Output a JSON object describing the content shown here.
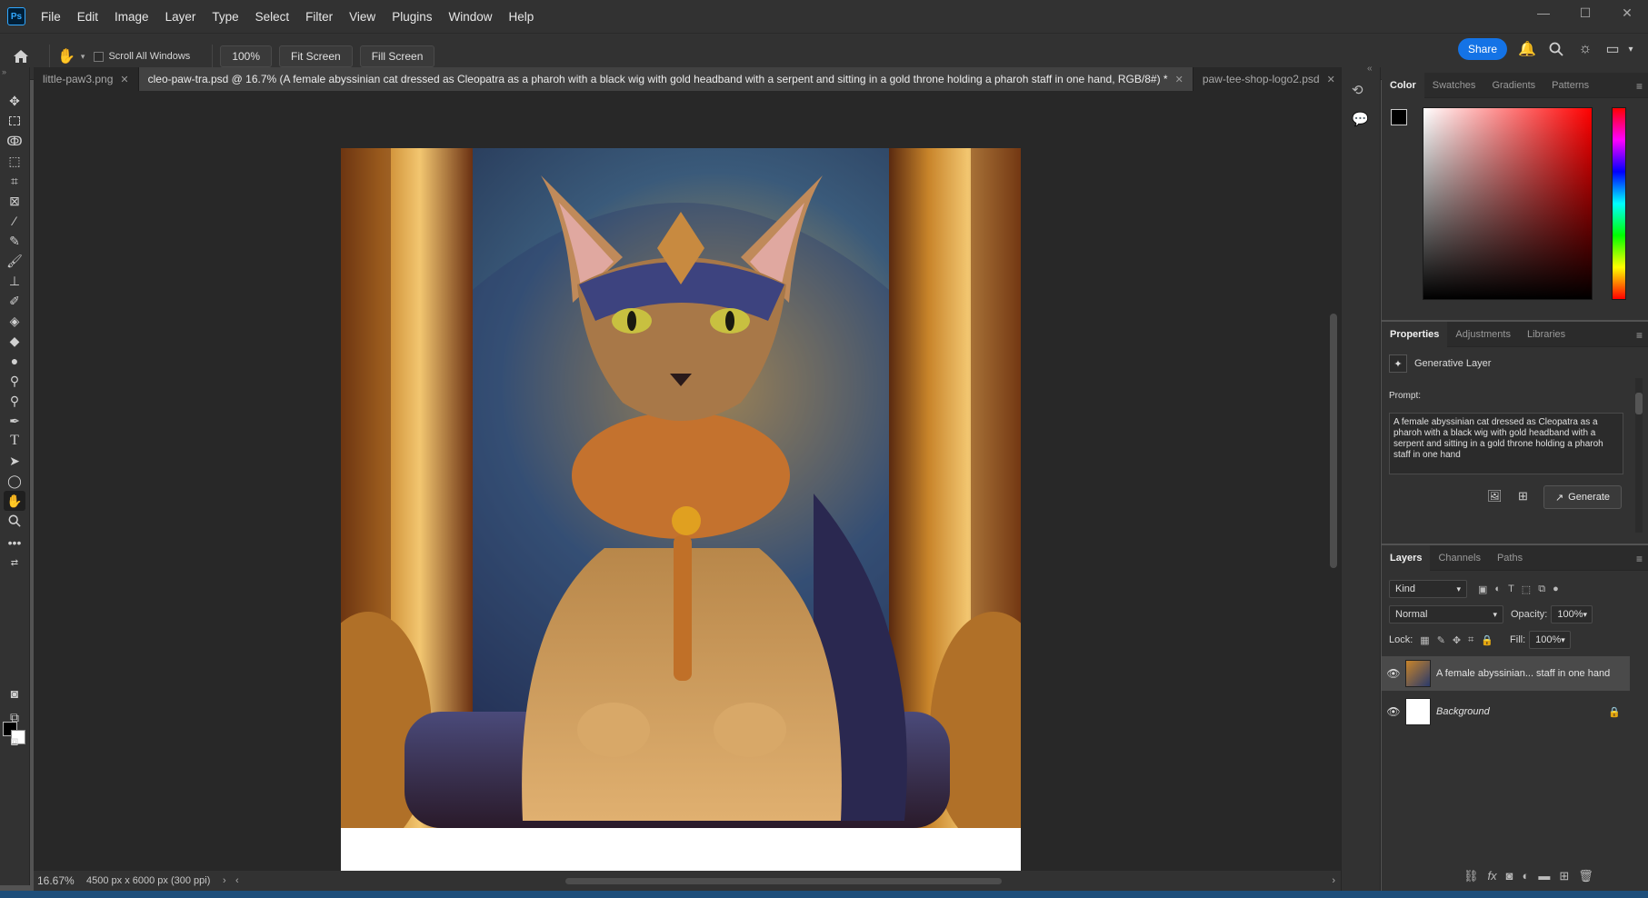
{
  "app": {
    "logo": "Ps",
    "menu": [
      "File",
      "Edit",
      "Image",
      "Layer",
      "Type",
      "Select",
      "Filter",
      "View",
      "Plugins",
      "Window",
      "Help"
    ]
  },
  "window_controls": {
    "minimize": "—",
    "maximize": "☐",
    "close": "✕"
  },
  "options_bar": {
    "scroll_all_label": "Scroll All Windows",
    "zoom_value": "100%",
    "fit_screen_label": "Fit Screen",
    "fill_screen_label": "Fill Screen",
    "share_label": "Share"
  },
  "tabs": [
    {
      "label": "little-paw3.png",
      "active": false
    },
    {
      "label": "cleo-paw-tra.psd @ 16.7% (A female abyssinian cat dressed as Cleopatra as a pharoh with a black wig with gold headband with a serpent and sitting in a gold throne holding a pharoh staff in one hand, RGB/8#) *",
      "active": true
    },
    {
      "label": "paw-tee-shop-logo2.psd",
      "active": false
    }
  ],
  "tools": [
    "move-tool",
    "marquee-tool",
    "lasso-tool",
    "object-select-tool",
    "crop-tool",
    "frame-tool",
    "eyedropper-tool",
    "healing-brush-tool",
    "brush-tool",
    "clone-stamp-tool",
    "history-brush-tool",
    "eraser-tool",
    "paint-bucket-tool",
    "blur-tool",
    "dodge-tool",
    "pen-tool",
    "type-tool",
    "path-select-tool",
    "ellipse-tool",
    "hand-tool",
    "zoom-tool",
    "more-tools"
  ],
  "status": {
    "zoom": "16.67%",
    "doc_info": "4500 px x 6000 px (300 ppi)"
  },
  "color_panel": {
    "tabs": [
      "Color",
      "Swatches",
      "Gradients",
      "Patterns"
    ],
    "active_tab": "Color",
    "foreground": "#000000",
    "background": "#ffffff",
    "hue": "#ff0000"
  },
  "properties_panel": {
    "tabs": [
      "Properties",
      "Adjustments",
      "Libraries"
    ],
    "layer_type": "Generative Layer",
    "prompt_label": "Prompt:",
    "prompt_text": "A female abyssinian cat dressed as Cleopatra as a pharoh with a black wig with gold headband with a serpent and sitting in a gold throne holding a pharoh staff in one hand",
    "generate_label": "Generate"
  },
  "layers_panel": {
    "tabs": [
      "Layers",
      "Channels",
      "Paths"
    ],
    "filter_kind": "Kind",
    "blend_mode": "Normal",
    "opacity_label": "Opacity:",
    "opacity_value": "100%",
    "lock_label": "Lock:",
    "fill_label": "Fill:",
    "fill_value": "100%",
    "layers": [
      {
        "name": "A female abyssinian... staff in one hand",
        "selected": true
      },
      {
        "name": "Background",
        "selected": false,
        "locked": true
      }
    ]
  }
}
